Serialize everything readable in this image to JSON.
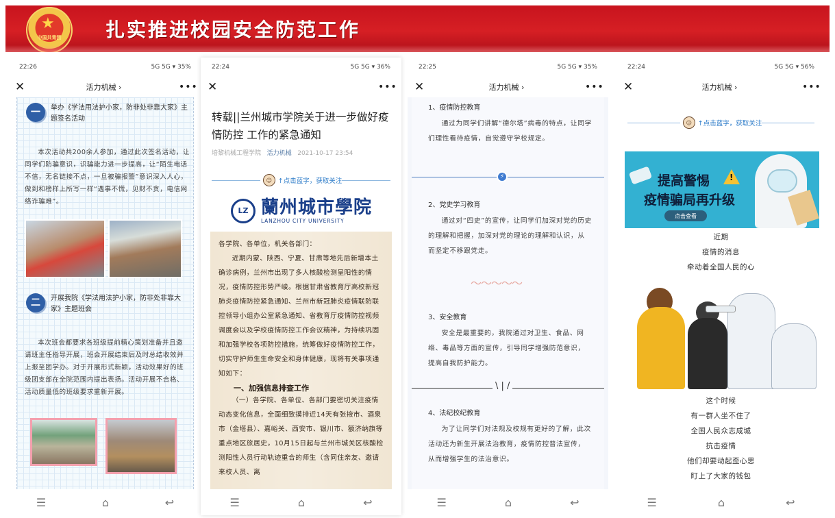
{
  "banner": {
    "title": "扎实推进校园安全防范工作",
    "emblem_text": "中国共青团",
    "emblem_icon": "star-icon"
  },
  "phones": [
    {
      "status": {
        "time": "22:26",
        "signal": "5G 5G ▾ 35%"
      },
      "nav": {
        "center": "活力机械 ›"
      },
      "sections": [
        {
          "num": "一",
          "heading": "举办《学法用法护小家，防非处非靠大家》主题签名活动",
          "body": "本次活动共200余人参加，通过此次签名活动，让同学们防骗意识，识骗能力进一步提高，让“陌生电话不信，无名链接不点，一旦被骗报警”意识深入人心，做到和榜样上所写一样“遇事不慌，见财不贪，电信网络诈骗难”。"
        },
        {
          "num": "二",
          "heading": "开展我院《学法用法护小家，防非处非靠大家》主题班会",
          "body": "本次班会都要求各班级提前精心策划准备并且邀请班主任指导开展，班会开展结束后及时总结收效并上报至团学办。对于开展形式新颖，活动效果好的班级团支部在全院范围内提出表扬。活动开展不合格、活动质量低的班级要求重新开展。"
        }
      ]
    },
    {
      "status": {
        "time": "22:24",
        "signal": "5G 5G ▾ 36%"
      },
      "nav": {
        "center": ""
      },
      "article": {
        "title": "转载||兰州城市学院关于进一步做好疫情防控 工作的紧急通知",
        "source": "培黎机械工程学院",
        "account": "活力机械",
        "date": "2021-10-17 23:54"
      },
      "follow": "↑点击蓝字，获取关注",
      "logo": {
        "cn": "蘭州城市學院",
        "en": "LANZHOU CITY UNIVERSITY",
        "seal": "LZ"
      },
      "notice": {
        "greeting": "各学院、各单位，机关各部门：",
        "p1": "近期内蒙、陕西、宁夏、甘肃等地先后新增本土确诊病例，兰州市出现了多人核酸检测呈阳性的情况，疫情防控形势严峻。根据甘肃省教育厅高校新冠肺炎疫情防控紧急通知、兰州市新冠肺炎疫情联防联控领导小组办公室紧急通知、省教育厅疫情防控视频调度会以及学校疫情防控工作会议精神，为持续巩固和加强学校各项防控措施，统筹做好疫情防控工作，切实守护师生生命安全和身体健康，现将有关事项通知如下：",
        "heading": "一、加强信息排查工作",
        "p2": "（一）各学院、各单位、各部门要密切关注疫情动态变化信息，全面细致摸排近14天有张掖市、酒泉市（金塔县）、嘉峪关、西安市、银川市、额济纳旗等重点地区旅居史，10月15日起与兰州市城关区核酸检测阳性人员行动轨迹重合的师生（含同住亲友、邀请来校人员、离"
      }
    },
    {
      "status": {
        "time": "22:25",
        "signal": "5G 5G ▾ 35%"
      },
      "nav": {
        "center": "活力机械 ›"
      },
      "items": [
        {
          "head": "1、疫情防控教育",
          "body": "通过为同学们讲解“德尔塔”病毒的特点，让同学们理性看待疫情，自觉遵守学校规定。"
        },
        {
          "head": "2、党史学习教育",
          "body": "通过对“四史”的宣传，让同学们加深对党的历史的理解和把握，加深对党的理论的理解和认识，从而坚定不移跟党走。"
        },
        {
          "head": "3、安全教育",
          "body": "安全是最重要的，我院通过对卫生、食品、网络、毒品等方面的宣传，引导同学增强防范意识，提高自我防护能力。"
        },
        {
          "head": "4、法纪校纪教育",
          "body": "为了让同学们对法规及校规有更好的了解，此次活动还为新生开展法治教育，疫情防控普法宣传，从而增强学生的法治意识。"
        }
      ]
    },
    {
      "status": {
        "time": "22:24",
        "signal": "5G 5G ▾ 56%"
      },
      "nav": {
        "center": "活力机械 ›"
      },
      "follow": "↑点击蓝字，获取关注",
      "promo": {
        "line1": "提高警惕",
        "line2": "疫情骗局再升级",
        "button": "点击查看"
      },
      "poem_top": [
        "近期",
        "疫情的消息",
        "牵动着全国人民的心"
      ],
      "poem_bottom": [
        "这个时候",
        "有一群人坐不住了",
        "全国人民众志成城",
        "抗击疫情",
        "他们却要动起歪心思",
        "盯上了大家的钱包"
      ]
    }
  ]
}
